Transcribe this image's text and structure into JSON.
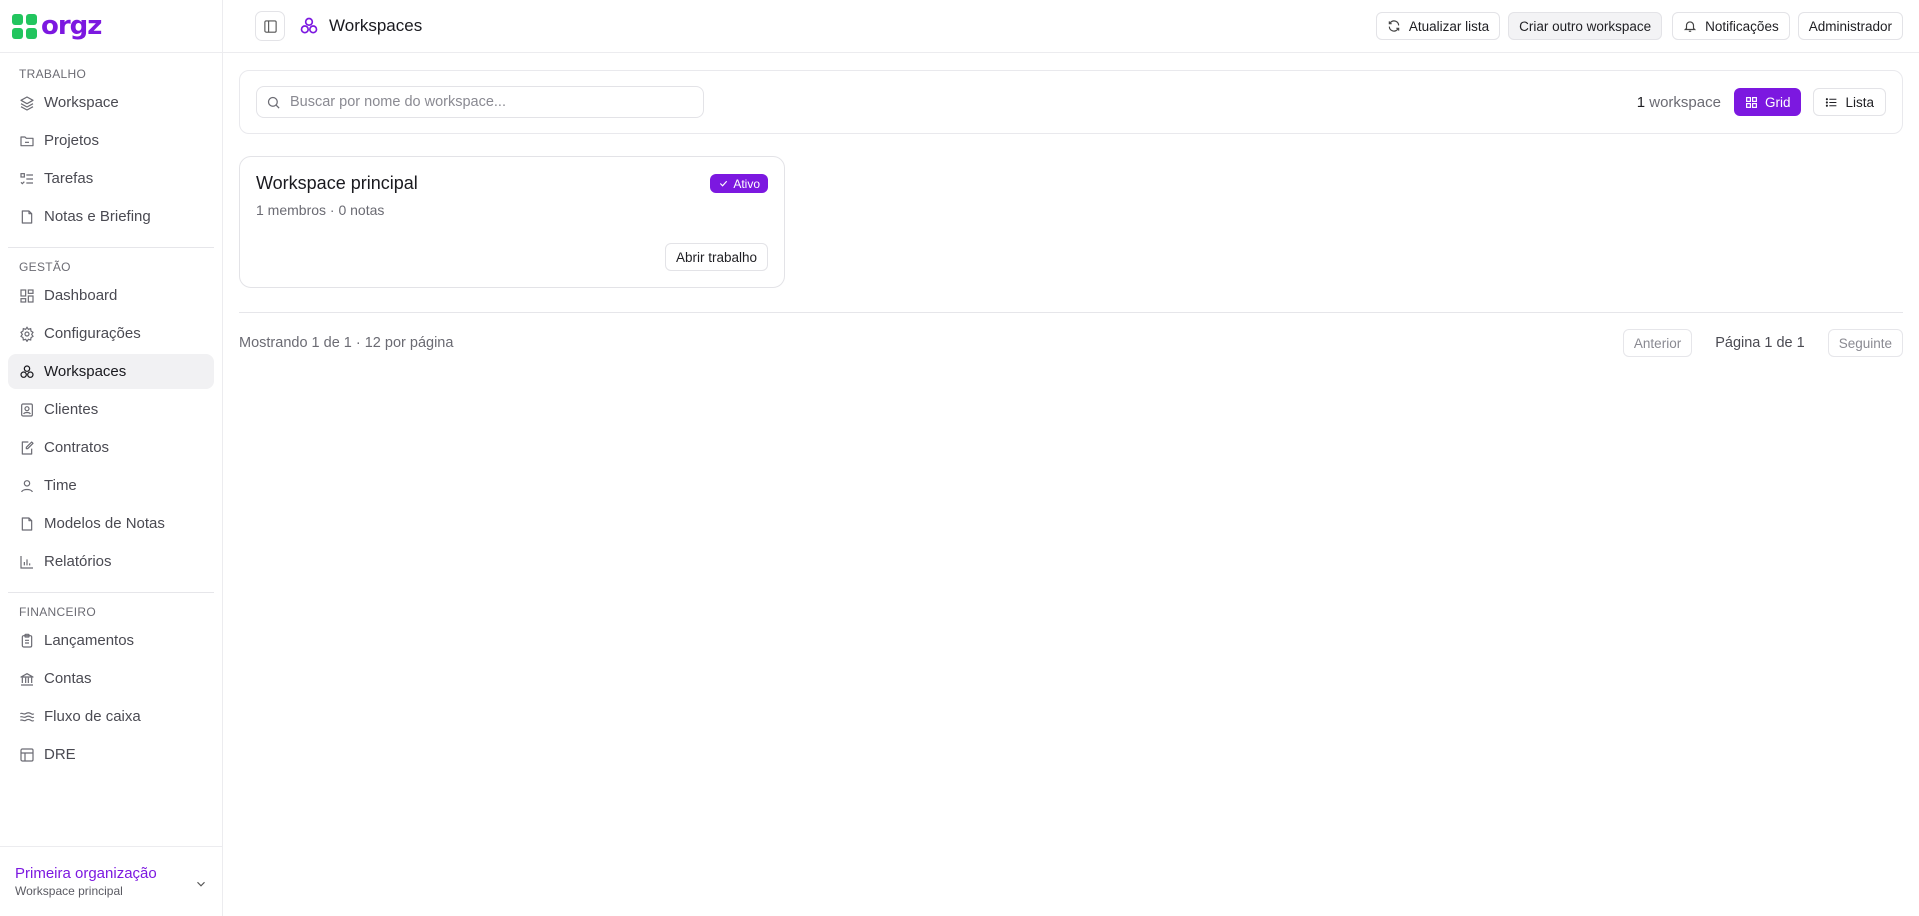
{
  "brand": {
    "name": "orgz",
    "colors": {
      "accent": "#7c18e0",
      "logo_green": "#22c55e"
    }
  },
  "sidebar": {
    "sections": [
      {
        "label": "TRABALHO",
        "items": [
          {
            "label": "Workspace",
            "icon": "layers-icon"
          },
          {
            "label": "Projetos",
            "icon": "folder-icon"
          },
          {
            "label": "Tarefas",
            "icon": "list-check-icon"
          },
          {
            "label": "Notas e Briefing",
            "icon": "note-icon"
          }
        ]
      },
      {
        "label": "GESTÃO",
        "items": [
          {
            "label": "Dashboard",
            "icon": "dashboard-icon"
          },
          {
            "label": "Configurações",
            "icon": "gear-icon"
          },
          {
            "label": "Workspaces",
            "icon": "workspaces-icon",
            "active": true
          },
          {
            "label": "Clientes",
            "icon": "contact-icon"
          },
          {
            "label": "Contratos",
            "icon": "contract-icon"
          },
          {
            "label": "Time",
            "icon": "user-icon"
          },
          {
            "label": "Modelos de Notas",
            "icon": "note-template-icon"
          },
          {
            "label": "Relatórios",
            "icon": "bar-chart-icon"
          }
        ]
      },
      {
        "label": "FINANCEIRO",
        "items": [
          {
            "label": "Lançamentos",
            "icon": "clipboard-icon"
          },
          {
            "label": "Contas",
            "icon": "bank-icon"
          },
          {
            "label": "Fluxo de caixa",
            "icon": "waves-icon"
          },
          {
            "label": "DRE",
            "icon": "table-icon"
          }
        ]
      }
    ],
    "org": {
      "name": "Primeira organização",
      "workspace": "Workspace principal"
    }
  },
  "header": {
    "title": "Workspaces",
    "actions": {
      "refresh": "Atualizar lista",
      "create": "Criar outro workspace",
      "notifications": "Notificações",
      "admin": "Administrador"
    }
  },
  "filters": {
    "search_placeholder": "Buscar por nome do workspace...",
    "count_number": "1",
    "count_label": "workspace",
    "view_grid": "Grid",
    "view_list": "Lista",
    "active_view": "grid"
  },
  "workspaces": [
    {
      "name": "Workspace principal",
      "meta": "1 membros · 0 notas",
      "status": "Ativo",
      "open_label": "Abrir trabalho"
    }
  ],
  "pagination": {
    "info": "Mostrando 1 de 1 · 12 por página",
    "previous": "Anterior",
    "page_label": "Página 1 de 1",
    "next": "Seguinte"
  }
}
